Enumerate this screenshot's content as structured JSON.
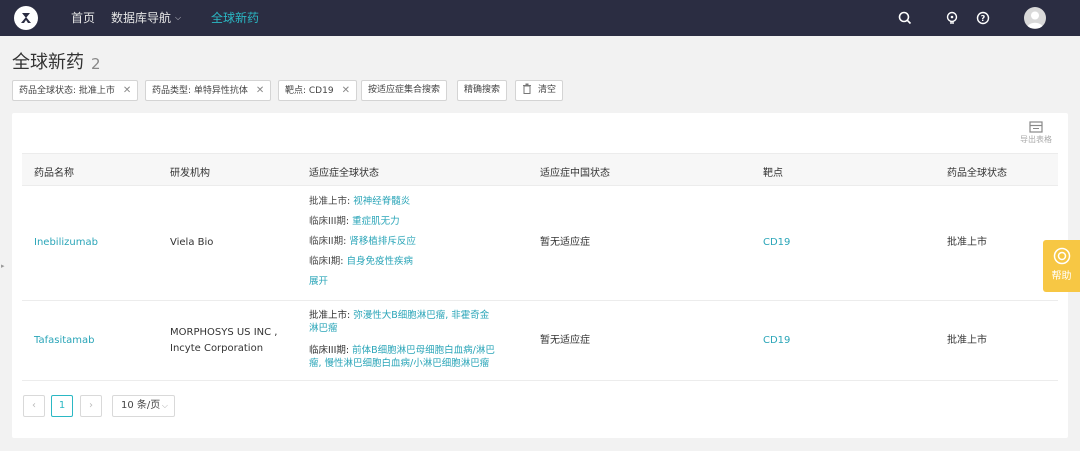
{
  "nav": {
    "home": "首页",
    "database_nav": "数据库导航",
    "global_new_drugs": "全球新药"
  },
  "page": {
    "title": "全球新药",
    "count": "2"
  },
  "filters": [
    {
      "label": "药品全球状态: 批准上市"
    },
    {
      "label": "药品类型: 单特异性抗体"
    },
    {
      "label": "靶点: CD19"
    }
  ],
  "actions": {
    "indication_search": "按适应症集合搜索",
    "precise_search": "精确搜索",
    "clear": "清空",
    "export": "导出表格"
  },
  "table": {
    "columns": [
      "药品名称",
      "研发机构",
      "适应症全球状态",
      "适应症中国状态",
      "靶点",
      "药品全球状态"
    ],
    "rows": [
      {
        "drug": "Inebilizumab",
        "org": "Viela Bio",
        "indications": [
          {
            "phase": "批准上市: ",
            "disease": "视神经脊髓炎"
          },
          {
            "phase": "临床III期: ",
            "disease": "重症肌无力"
          },
          {
            "phase": "临床II期: ",
            "disease": "肾移植排斥反应"
          },
          {
            "phase": "临床I期: ",
            "disease": "自身免疫性疾病"
          }
        ],
        "expand": "展开",
        "china_status": "暂无适应症",
        "target": "CD19",
        "global_status": "批准上市"
      },
      {
        "drug": "Tafasitamab",
        "org_line1": "MORPHOSYS US INC ,",
        "org_line2": "Incyte Corporation",
        "ind1_phase": "批准上市: ",
        "ind1_disease_a": "弥漫性大B细胞淋巴瘤, 非霍奇金",
        "ind1_disease_b": "淋巴瘤",
        "ind2_phase": "临床III期: ",
        "ind2_disease_a": "前体B细胞淋巴母细胞白血病/淋巴",
        "ind2_disease_b": "瘤, 慢性淋巴细胞白血病/小淋巴细胞淋巴瘤",
        "china_status": "暂无适应症",
        "target": "CD19",
        "global_status": "批准上市"
      }
    ]
  },
  "pagination": {
    "prev": "‹",
    "current": "1",
    "next": "›",
    "page_size": "10 条/页"
  },
  "help": "帮助",
  "colors": {
    "nav_bg": "#2b2d42",
    "accent": "#2bb8c4",
    "link": "#2aa5b8",
    "help_bg": "#f7c744"
  }
}
